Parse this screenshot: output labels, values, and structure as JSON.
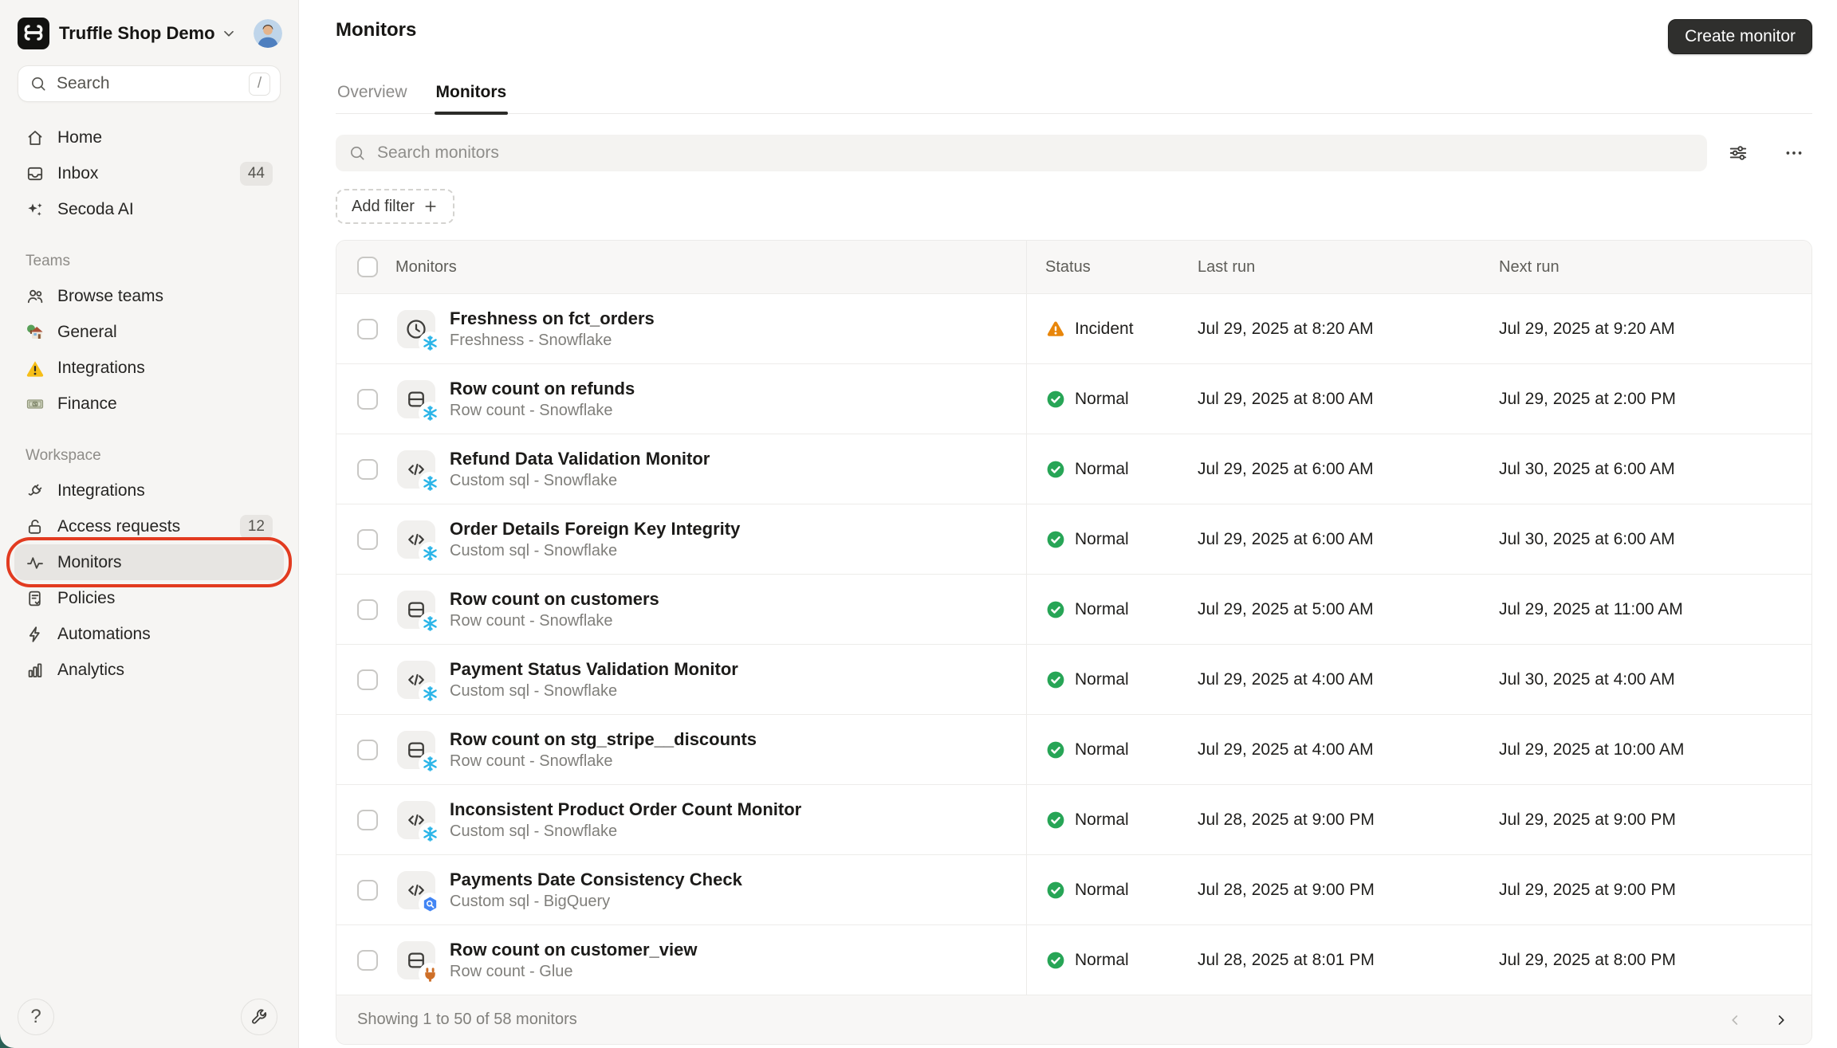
{
  "sidebar": {
    "workspace": {
      "name": "Truffle Shop Demo",
      "logo_icon": "secoda-logo",
      "chevron_icon": "chevron-down-icon",
      "avatar_icon": "user-avatar"
    },
    "search": {
      "placeholder": "Search",
      "shortcut": "/",
      "icon": "search-icon"
    },
    "nav": [
      {
        "label": "Home",
        "icon": "home-icon"
      },
      {
        "label": "Inbox",
        "icon": "inbox-icon",
        "badge": "44"
      },
      {
        "label": "Secoda AI",
        "icon": "sparkles-icon"
      }
    ],
    "sections": [
      {
        "title": "Teams",
        "items": [
          {
            "label": "Browse teams",
            "icon": "people-icon"
          },
          {
            "label": "General",
            "icon": "house-garden-icon"
          },
          {
            "label": "Integrations",
            "icon": "warning-emoji-icon"
          },
          {
            "label": "Finance",
            "icon": "banknote-icon"
          }
        ]
      },
      {
        "title": "Workspace",
        "items": [
          {
            "label": "Integrations",
            "icon": "plug-icon"
          },
          {
            "label": "Access requests",
            "icon": "unlock-icon",
            "badge": "12"
          },
          {
            "label": "Monitors",
            "icon": "pulse-icon",
            "selected": true,
            "annotated": true
          },
          {
            "label": "Policies",
            "icon": "policy-icon"
          },
          {
            "label": "Automations",
            "icon": "bolt-icon"
          },
          {
            "label": "Analytics",
            "icon": "bar-chart-icon"
          }
        ]
      }
    ],
    "bottom": {
      "help_icon": "question-icon",
      "tools_icon": "wrench-icon"
    }
  },
  "header": {
    "title": "Monitors",
    "create_button": "Create monitor",
    "tabs": [
      {
        "label": "Overview",
        "active": false
      },
      {
        "label": "Monitors",
        "active": true
      }
    ]
  },
  "toolbar": {
    "search_placeholder": "Search monitors",
    "filter_icon": "sliders-icon",
    "more_icon": "ellipsis-icon",
    "add_filter_label": "Add filter"
  },
  "table": {
    "columns": [
      "Monitors",
      "Status",
      "Last run",
      "Next run"
    ],
    "rows": [
      {
        "name": "Freshness on fct_orders",
        "subtitle": "Freshness - Snowflake",
        "icon": "clock-icon",
        "badge": "snowflake-badge",
        "status": "Incident",
        "status_type": "incident",
        "last_run": "Jul 29, 2025 at 8:20 AM",
        "next_run": "Jul 29, 2025 at 9:20 AM"
      },
      {
        "name": "Row count on refunds",
        "subtitle": "Row count - Snowflake",
        "icon": "rows-icon",
        "badge": "snowflake-badge",
        "status": "Normal",
        "status_type": "normal",
        "last_run": "Jul 29, 2025 at 8:00 AM",
        "next_run": "Jul 29, 2025 at 2:00 PM"
      },
      {
        "name": "Refund Data Validation Monitor",
        "subtitle": "Custom sql - Snowflake",
        "icon": "code-icon",
        "badge": "snowflake-badge",
        "status": "Normal",
        "status_type": "normal",
        "last_run": "Jul 29, 2025 at 6:00 AM",
        "next_run": "Jul 30, 2025 at 6:00 AM"
      },
      {
        "name": "Order Details Foreign Key Integrity",
        "subtitle": "Custom sql - Snowflake",
        "icon": "code-icon",
        "badge": "snowflake-badge",
        "status": "Normal",
        "status_type": "normal",
        "last_run": "Jul 29, 2025 at 6:00 AM",
        "next_run": "Jul 30, 2025 at 6:00 AM"
      },
      {
        "name": "Row count on customers",
        "subtitle": "Row count - Snowflake",
        "icon": "rows-icon",
        "badge": "snowflake-badge",
        "status": "Normal",
        "status_type": "normal",
        "last_run": "Jul 29, 2025 at 5:00 AM",
        "next_run": "Jul 29, 2025 at 11:00 AM"
      },
      {
        "name": "Payment Status Validation Monitor",
        "subtitle": "Custom sql - Snowflake",
        "icon": "code-icon",
        "badge": "snowflake-badge",
        "status": "Normal",
        "status_type": "normal",
        "last_run": "Jul 29, 2025 at 4:00 AM",
        "next_run": "Jul 30, 2025 at 4:00 AM"
      },
      {
        "name": "Row count on stg_stripe__discounts",
        "subtitle": "Row count - Snowflake",
        "icon": "rows-icon",
        "badge": "snowflake-badge",
        "status": "Normal",
        "status_type": "normal",
        "last_run": "Jul 29, 2025 at 4:00 AM",
        "next_run": "Jul 29, 2025 at 10:00 AM"
      },
      {
        "name": "Inconsistent Product Order Count Monitor",
        "subtitle": "Custom sql - Snowflake",
        "icon": "code-icon",
        "badge": "snowflake-badge",
        "status": "Normal",
        "status_type": "normal",
        "last_run": "Jul 28, 2025 at 9:00 PM",
        "next_run": "Jul 29, 2025 at 9:00 PM"
      },
      {
        "name": "Payments Date Consistency Check",
        "subtitle": "Custom sql - BigQuery",
        "icon": "code-icon",
        "badge": "bigquery-badge",
        "status": "Normal",
        "status_type": "normal",
        "last_run": "Jul 28, 2025 at 9:00 PM",
        "next_run": "Jul 29, 2025 at 9:00 PM"
      },
      {
        "name": "Row count on customer_view",
        "subtitle": "Row count - Glue",
        "icon": "rows-icon",
        "badge": "glue-badge",
        "status": "Normal",
        "status_type": "normal",
        "last_run": "Jul 28, 2025 at 8:01 PM",
        "next_run": "Jul 29, 2025 at 8:00 PM"
      }
    ],
    "footer": {
      "summary": "Showing 1 to 50 of 58 monitors",
      "prev_icon": "chevron-left-icon",
      "next_icon": "chevron-right-icon"
    }
  },
  "colors": {
    "status_incident": "#E8860A",
    "status_normal": "#27A556",
    "snowflake_blue": "#2BB5E8",
    "bigquery_blue": "#4285F4",
    "glue_orange": "#CE6F28",
    "annotation_red": "#E23B20",
    "create_button_bg": "#2F2F2D",
    "sidebar_bg": "#F6F5F3",
    "corner_teal": "#2A5F55"
  }
}
